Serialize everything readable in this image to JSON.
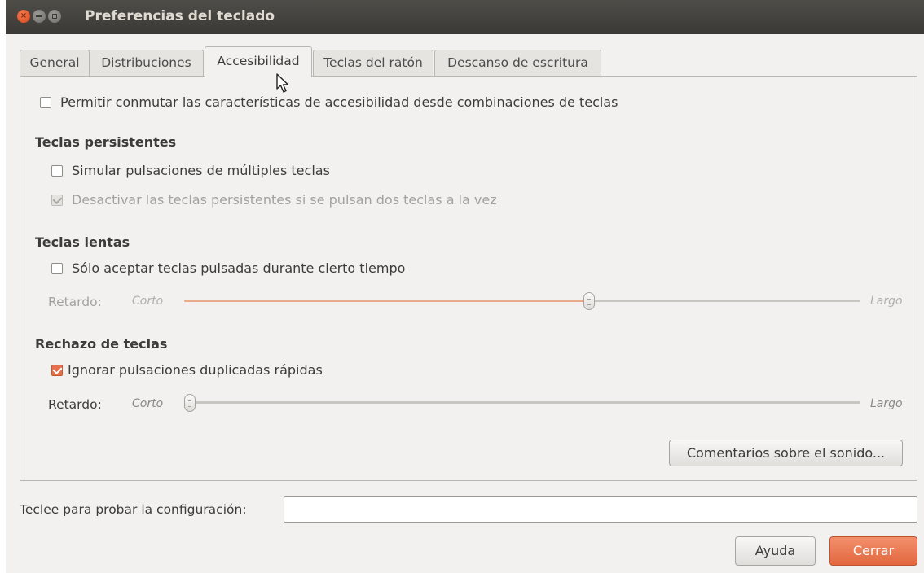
{
  "window": {
    "title": "Preferencias del teclado"
  },
  "tabs": [
    {
      "label": "General"
    },
    {
      "label": "Distribuciones"
    },
    {
      "label": "Accesibilidad"
    },
    {
      "label": "Teclas del ratón"
    },
    {
      "label": "Descanso de escritura"
    }
  ],
  "active_tab": "Accesibilidad",
  "accessibility": {
    "toggle_shortcuts": {
      "label": "Permitir conmutar las características de accesibilidad desde combinaciones de teclas",
      "checked": false
    },
    "sticky": {
      "heading": "Teclas persistentes",
      "simulate": {
        "label": "Simular pulsaciones de múltiples teclas",
        "checked": false
      },
      "disable_two": {
        "label": "Desactivar las teclas persistentes si se pulsan dos teclas a la vez",
        "checked": true,
        "enabled": false
      }
    },
    "slow": {
      "heading": "Teclas lentas",
      "accept": {
        "label": "Sólo aceptar teclas pulsadas durante cierto tiempo",
        "checked": false
      },
      "delay": {
        "label": "Retardo:",
        "min_label": "Corto",
        "max_label": "Largo",
        "level": 0.6,
        "enabled": false
      }
    },
    "bounce": {
      "heading": "Rechazo de teclas",
      "ignore": {
        "label": "Ignorar pulsaciones duplicadas rápidas",
        "checked": true
      },
      "delay": {
        "label": "Retardo:",
        "min_label": "Corto",
        "max_label": "Largo",
        "level": 0.0,
        "enabled": true
      }
    },
    "sound_button": "Comentarios sobre el sonido..."
  },
  "test_field": {
    "label": "Teclee para probar la configuración:",
    "value": ""
  },
  "buttons": {
    "help": "Ayuda",
    "close": "Cerrar"
  },
  "colors": {
    "accent": "#e5704b",
    "titlebar": "#3f3e3a"
  },
  "icons": {
    "window_close": "close-icon",
    "window_minimize": "minimize-icon",
    "window_maximize": "maximize-icon",
    "pointer": "mouse-pointer-icon"
  }
}
